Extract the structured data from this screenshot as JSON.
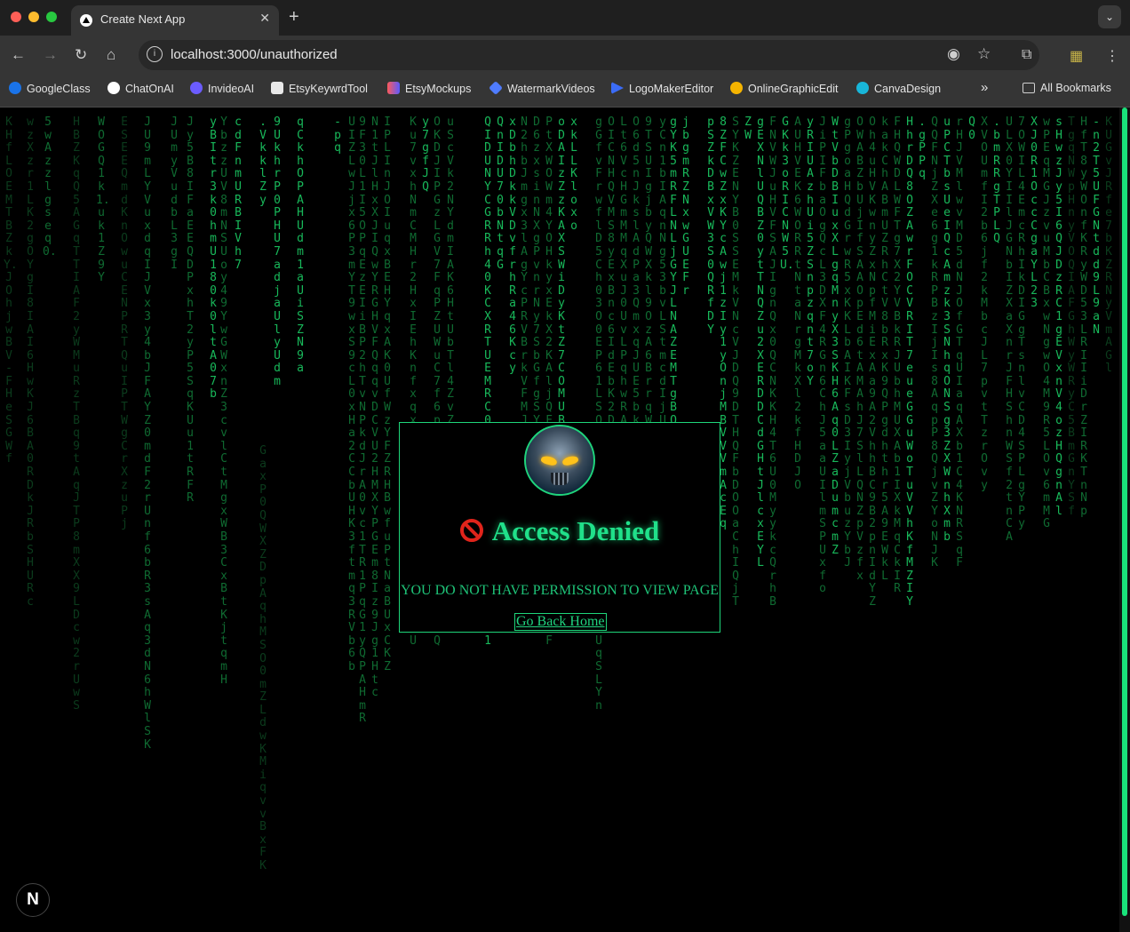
{
  "browser": {
    "tab_title": "Create Next App",
    "url": "localhost:3000/unauthorized",
    "bookmarks": [
      "GoogleClass",
      "ChatOnAI",
      "InvideoAI",
      "EtsyKeywrdTool",
      "EtsyMockups",
      "WatermarkVideos",
      "LogoMakerEditor",
      "OnlineGraphicEdit",
      "CanvaDesign"
    ],
    "all_bookmarks": "All Bookmarks",
    "icons": [
      "back-arrow",
      "forward-arrow",
      "reload",
      "home",
      "site-info",
      "eye",
      "star",
      "extensions",
      "profile",
      "menu"
    ]
  },
  "matrix_columns": [
    "5wAzzlgseq0.",
    "WOGQ1k1.uk1Z9Y",
    "JUmyVudbL3gI",
    "yBItr3k0hmU180k0ltA07b",
    "cdFnmURBIVh7",
    "9UkhrP0PHU7adjaUlyUdm",
    "qCkhOPAHUdm1aUiSZN9a",
    "-pq",
    "y7gfJQ",
    "QnIDU70bNtqG",
    "xDbhDkkVDvfrhRa46Kcy",
    "xkLLKloxo",
    "jbgmRZNxwGUEFr",
    "pSZkDBxVW3S0QRfDY",
    "ZW",
    "GKk3oRICNW5U.",
    "yRIUAzhUi5ZSnpzqnt7oY",
    ".gPPq",
    "Q0",
    ".bmRRgTPLQ",
    "XJ0R1OccCgaYL23",
    "-n2T5UFGNtdd9L9aN"
  ],
  "dialog": {
    "title": "Access Denied",
    "message": "YOU DO NOT HAVE PERMISSION TO VIEW PAGE",
    "button": "Go Back Home"
  },
  "next_badge": "N",
  "colors": {
    "accent": "#1ed67a",
    "stop": "#e0241b",
    "eye": "#ffc21a"
  }
}
